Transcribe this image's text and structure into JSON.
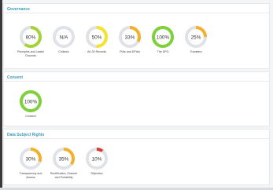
{
  "sections": [
    {
      "title": "Governance",
      "items": [
        {
          "value": "60%",
          "pct": 60,
          "color": "#a5d337",
          "label": "Principles and Lawful Grounds"
        },
        {
          "value": "N/A",
          "pct": 0,
          "color": "#cfd3d8",
          "label": "Children"
        },
        {
          "value": "50%",
          "pct": 50,
          "color": "#f4e32a",
          "label": "Art 30 Records"
        },
        {
          "value": "33%",
          "pct": 33,
          "color": "#f3b02b",
          "label": "PIAs and DPIAs"
        },
        {
          "value": "100%",
          "pct": 100,
          "color": "#7ed13b",
          "label": "The DPO"
        },
        {
          "value": "25%",
          "pct": 25,
          "color": "#f3b02b",
          "label": "Transfers"
        }
      ]
    },
    {
      "title": "Consent",
      "items": [
        {
          "value": "100%",
          "pct": 100,
          "color": "#7ed13b",
          "label": "Consent"
        }
      ]
    },
    {
      "title": "Data Subject Rights",
      "items": [
        {
          "value": "30%",
          "pct": 30,
          "color": "#f3b02b",
          "label": "Transparency and Access"
        },
        {
          "value": "35%",
          "pct": 35,
          "color": "#f3b02b",
          "label": "Rectification, Erasure and Portability"
        },
        {
          "value": "10%",
          "pct": 10,
          "color": "#e0392b",
          "label": "Objection"
        }
      ]
    }
  ],
  "colors": {
    "track": "#dfe2e6",
    "title": "#3a9bb8"
  }
}
